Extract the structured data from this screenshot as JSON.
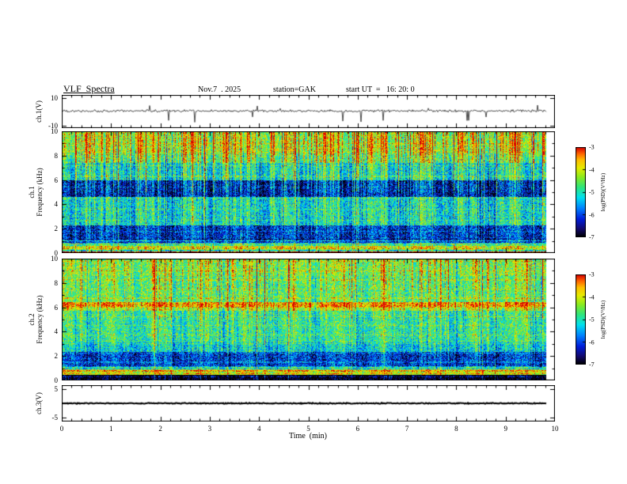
{
  "header": {
    "title": "VLF  Spectra",
    "date": "Nov.7  . 2025",
    "station": "station=GAK",
    "start_ut": "start UT  =   16: 20: 0"
  },
  "chart_data": {
    "type": "heatmap",
    "title": "VLF Spectra, station GAK, Nov.7 2025, start UT 16:20:0",
    "xaxis": {
      "label": "Time  (min)",
      "range": [
        0,
        10
      ],
      "ticks": [
        0,
        1,
        2,
        3,
        4,
        5,
        6,
        7,
        8,
        9,
        10
      ],
      "minor_step_min": 0.2,
      "data_end_min": 9.82
    },
    "waveform_ch1": {
      "type": "line",
      "ylabel": "ch.1(V)",
      "ylim": [
        -12,
        12
      ],
      "yticks": [
        10,
        -10
      ],
      "baseline_v": 0.4,
      "noise_amp_v": 1.05,
      "down_spike_prob": 0.013,
      "down_spike_v": -9,
      "up_spike_prob": 0.006,
      "up_spike_v": 4,
      "seed": 1107,
      "description": "dense broadband noise trace near 0 V with intermittent impulsive downward spikes"
    },
    "spectrogram_ch1": {
      "type": "heatmap",
      "ylabel_line1": "ch.1",
      "ylabel_line2": "Frequency  (kHz)",
      "ylim": [
        0,
        10
      ],
      "yticks": [
        0,
        2,
        4,
        6,
        8,
        10
      ],
      "value_range": [
        -7,
        -3
      ],
      "noise": 0.8,
      "seed": 20251107,
      "bands": [
        {
          "f0": 0.0,
          "f1": 0.12,
          "level": -3.3
        },
        {
          "f0": 0.12,
          "f1": 0.3,
          "level": -4.8
        },
        {
          "f0": 0.3,
          "f1": 0.5,
          "level": -3.8
        },
        {
          "f0": 0.5,
          "f1": 0.75,
          "level": -4.6
        },
        {
          "f0": 0.75,
          "f1": 1.05,
          "level": -5.8
        },
        {
          "f0": 1.05,
          "f1": 2.3,
          "level": -6.2
        },
        {
          "f0": 2.3,
          "f1": 4.6,
          "level": -5.25
        },
        {
          "f0": 4.6,
          "f1": 6.0,
          "level": -6.45
        },
        {
          "f0": 6.0,
          "f1": 7.4,
          "level": -5.3
        },
        {
          "f0": 7.4,
          "f1": 8.2,
          "level": -4.8
        },
        {
          "f0": 8.2,
          "f1": 10.0,
          "level": -4.4
        }
      ],
      "streaks": {
        "density": 0.5,
        "boost": 1.5,
        "full_prob": 0.07,
        "dark_gap_prob": 0.13,
        "dark_gap": -0.55
      },
      "harmonics": {
        "spacing_khz": 0.9,
        "boost": 0.35
      }
    },
    "spectrogram_ch2": {
      "type": "heatmap",
      "ylabel_line1": "ch.2",
      "ylabel_line2": "Frequency  (kHz)",
      "ylim": [
        0,
        10
      ],
      "yticks": [
        0,
        2,
        4,
        6,
        8,
        10
      ],
      "value_range": [
        -7,
        -3
      ],
      "noise": 0.8,
      "seed": 77162,
      "bands": [
        {
          "f0": 0.0,
          "f1": 0.45,
          "level": -7.0
        },
        {
          "f0": 0.45,
          "f1": 0.6,
          "level": -4.2
        },
        {
          "f0": 0.6,
          "f1": 0.9,
          "level": -3.8
        },
        {
          "f0": 0.9,
          "f1": 1.15,
          "level": -5.2
        },
        {
          "f0": 1.15,
          "f1": 2.35,
          "level": -6.15
        },
        {
          "f0": 2.35,
          "f1": 3.1,
          "level": -5.3
        },
        {
          "f0": 3.1,
          "f1": 5.7,
          "level": -4.95
        },
        {
          "f0": 5.7,
          "f1": 6.05,
          "level": -4.3
        },
        {
          "f0": 6.05,
          "f1": 6.45,
          "level": -3.65
        },
        {
          "f0": 6.45,
          "f1": 7.3,
          "level": -4.7
        },
        {
          "f0": 7.3,
          "f1": 8.6,
          "level": -4.75
        },
        {
          "f0": 8.6,
          "f1": 10.0,
          "level": -4.55
        }
      ],
      "streaks": {
        "density": 0.42,
        "boost": 1.25,
        "full_prob": 0.06,
        "dark_gap_prob": 0.11,
        "dark_gap": -0.5
      },
      "harmonics": {
        "spacing_khz": 0.75,
        "boost": 0.4
      }
    },
    "waveform_ch3": {
      "type": "line",
      "ylabel": "ch.3(V)",
      "ylim": [
        -6.5,
        6.5
      ],
      "yticks": [
        5,
        -5
      ],
      "baseline_v": 0,
      "noise_amp_v": 0.22,
      "down_spike_prob": 0,
      "down_spike_v": 0,
      "up_spike_prob": 0,
      "up_spike_v": 0,
      "seed": 333,
      "description": "flat quiescent trace at 0 V"
    },
    "colorbar": {
      "label": "log(PSD)(V²/Hz)",
      "range": [
        -7,
        -3
      ],
      "ticks": [
        -3,
        -4,
        -5,
        -6,
        -7
      ]
    }
  }
}
